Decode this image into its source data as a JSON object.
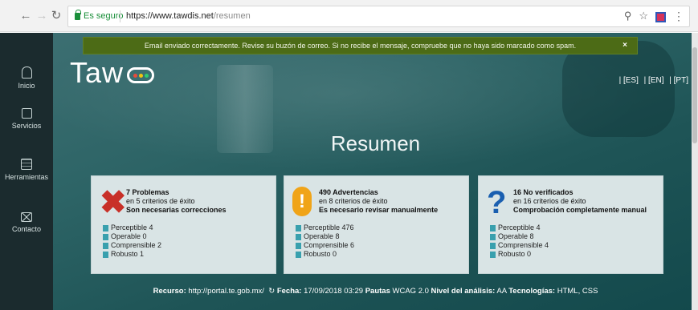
{
  "browser": {
    "secure_label": "Es seguro",
    "url_host": "https://www.tawdis.net",
    "url_path": "/resumen"
  },
  "sidebar": {
    "items": [
      {
        "label": "Inicio",
        "icon": "home-icon"
      },
      {
        "label": "Servicios",
        "icon": "briefcase-icon"
      },
      {
        "label": "Herramientas",
        "icon": "tools-icon"
      },
      {
        "label": "Contacto",
        "icon": "mail-icon"
      }
    ]
  },
  "flash": {
    "message": "Email enviado correctamente. Revise su buzón de correo. Si no recibe el mensaje, compruebe que no haya sido marcado como spam.",
    "close": "×"
  },
  "logo": {
    "text": "Taw",
    "dot_colors": [
      "#e74c3c",
      "#f1c40f",
      "#2ecc71"
    ]
  },
  "languages": [
    "| [ES]",
    "| [EN]",
    "| [PT]"
  ],
  "title": "Resumen",
  "cards": [
    {
      "icon": "x-icon",
      "heading": "7 Problemas",
      "subheading": "en 5 criterios de éxito",
      "note": "Son necesarias correcciones",
      "items": [
        "Perceptible 4",
        "Operable 0",
        "Comprensible 2",
        "Robusto 1"
      ]
    },
    {
      "icon": "warning-icon",
      "heading": "490 Advertencias",
      "subheading": "en 8 criterios de éxito",
      "note": "Es necesario revisar manualmente",
      "items": [
        "Perceptible 476",
        "Operable 8",
        "Comprensible 6",
        "Robusto 0"
      ]
    },
    {
      "icon": "question-icon",
      "heading": "16 No verificados",
      "subheading": "en 16 criterios de éxito",
      "note": "Comprobación completamente manual",
      "items": [
        "Perceptible 4",
        "Operable 8",
        "Comprensible 4",
        "Robusto 0"
      ]
    }
  ],
  "footer": {
    "resource_label": "Recurso:",
    "resource_value": "http://portal.te.gob.mx/",
    "date_label": "Fecha:",
    "date_value": "17/09/2018 03:29",
    "guidelines_label": "Pautas",
    "guidelines_value": "WCAG 2.0",
    "level_label": "Nivel del análisis:",
    "level_value": "AA",
    "tech_label": "Tecnologías:",
    "tech_value": "HTML, CSS"
  }
}
